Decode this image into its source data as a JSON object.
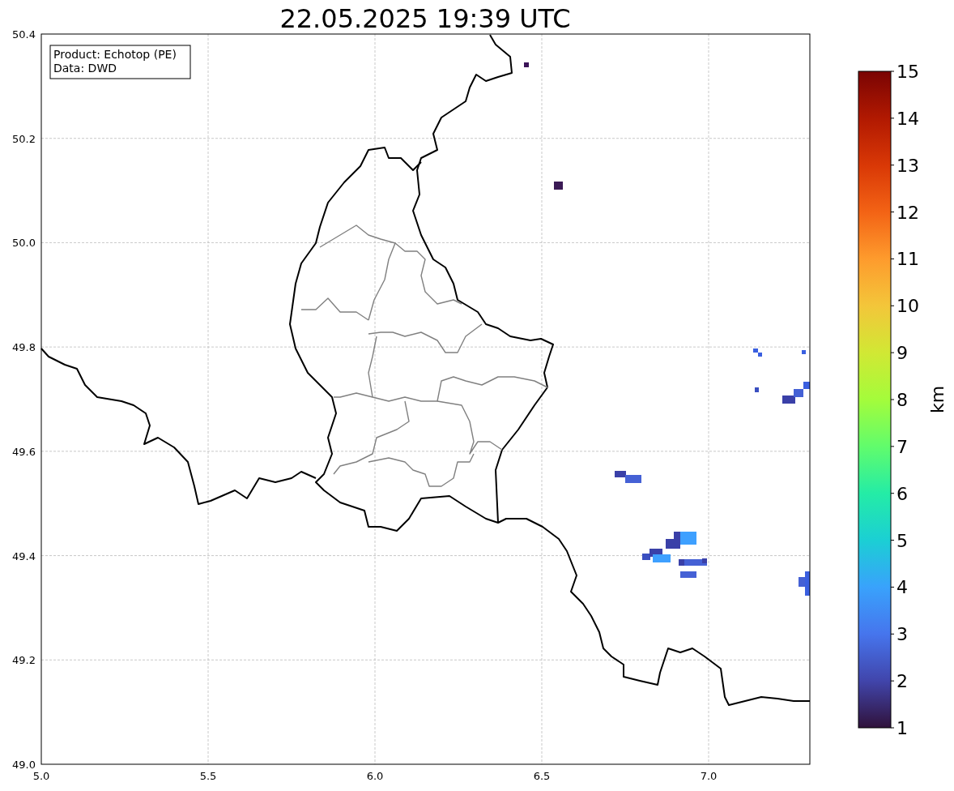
{
  "title": "22.05.2025 19:39 UTC",
  "info_box": [
    "Product: Echotop (PE)",
    "Data: DWD"
  ],
  "x_ticks": [
    "5.0",
    "5.5",
    "6.0",
    "6.5",
    "7.0"
  ],
  "y_ticks": [
    "50.4",
    "50.2",
    "50.0",
    "49.8",
    "49.6",
    "49.4",
    "49.2",
    "49.0"
  ],
  "colorbar": {
    "label": "km",
    "ticks": [
      "15",
      "14",
      "13",
      "12",
      "11",
      "10",
      "9",
      "8",
      "7",
      "6",
      "5",
      "4",
      "3",
      "2",
      "1"
    ]
  }
}
